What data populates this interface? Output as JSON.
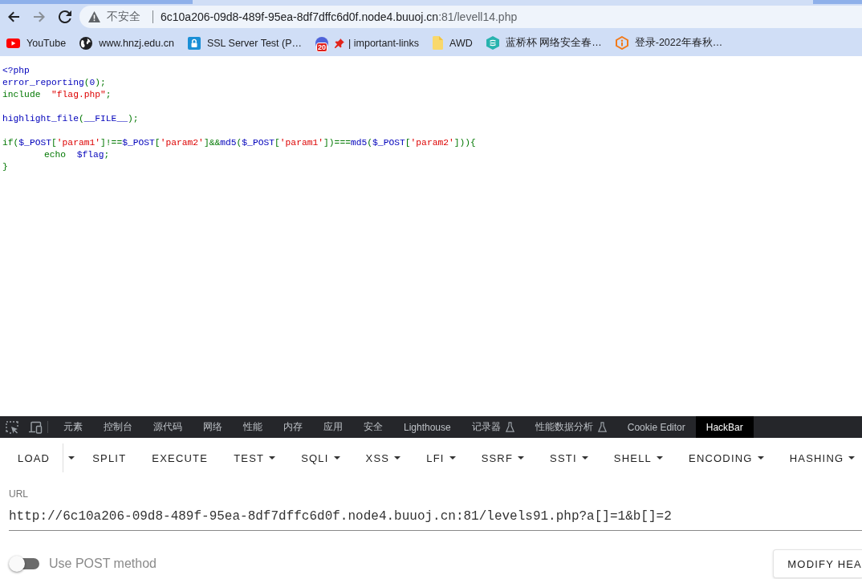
{
  "browser": {
    "nav_buttons": [
      {
        "kind": "back",
        "disabled": false
      },
      {
        "kind": "forward",
        "disabled": true
      },
      {
        "kind": "reload",
        "disabled": false
      }
    ],
    "address_bar": {
      "security_label": "不安全",
      "host": "6c10a206-09d8-489f-95ea-8df7dffc6d0f.node4.buuoj.cn",
      "path": ":81/levell14.php"
    },
    "bookmarks": [
      {
        "title": "YouTube",
        "kind": "play",
        "pinned": false
      },
      {
        "title": "www.hnzj.edu.cn",
        "kind": "globe",
        "pinned": false
      },
      {
        "title": "SSL Server Test (P…",
        "kind": "lock",
        "pinned": false
      },
      {
        "title": "| important-links",
        "kind": "counter",
        "badge": "20",
        "pinned": true
      },
      {
        "title": "AWD",
        "kind": "folder",
        "pinned": false
      },
      {
        "title": "蓝桥杯 网络安全春…",
        "kind": "stack",
        "pinned": false
      },
      {
        "title": "登录-2022年春秋…",
        "kind": "info",
        "pinned": false
      }
    ]
  },
  "page": {
    "code_lines": [
      {
        "kind": "code",
        "tokens": [
          {
            "text": "<?php",
            "kind": "default"
          }
        ]
      },
      {
        "kind": "code",
        "tokens": [
          {
            "text": "error_reporting",
            "kind": "default"
          },
          {
            "text": "(",
            "kind": "keyword"
          },
          {
            "text": "0",
            "kind": "default"
          },
          {
            "text": ");",
            "kind": "keyword"
          }
        ]
      },
      {
        "kind": "code",
        "tokens": [
          {
            "text": "include  ",
            "kind": "keyword"
          },
          {
            "text": "\"flag.php\"",
            "kind": "string"
          },
          {
            "text": ";",
            "kind": "keyword"
          }
        ]
      },
      {
        "kind": "blank"
      },
      {
        "kind": "code",
        "tokens": [
          {
            "text": "highlight_file",
            "kind": "default"
          },
          {
            "text": "(",
            "kind": "keyword"
          },
          {
            "text": "__FILE__",
            "kind": "default"
          },
          {
            "text": ");",
            "kind": "keyword"
          }
        ]
      },
      {
        "kind": "blank"
      },
      {
        "kind": "code",
        "tokens": [
          {
            "text": "if(",
            "kind": "keyword"
          },
          {
            "text": "$_POST",
            "kind": "default"
          },
          {
            "text": "[",
            "kind": "keyword"
          },
          {
            "text": "'param1'",
            "kind": "string"
          },
          {
            "text": "]!==",
            "kind": "keyword"
          },
          {
            "text": "$_POST",
            "kind": "default"
          },
          {
            "text": "[",
            "kind": "keyword"
          },
          {
            "text": "'param2'",
            "kind": "string"
          },
          {
            "text": "]&&",
            "kind": "keyword"
          },
          {
            "text": "md5",
            "kind": "default"
          },
          {
            "text": "(",
            "kind": "keyword"
          },
          {
            "text": "$_POST",
            "kind": "default"
          },
          {
            "text": "[",
            "kind": "keyword"
          },
          {
            "text": "'param1'",
            "kind": "string"
          },
          {
            "text": "])===",
            "kind": "keyword"
          },
          {
            "text": "md5",
            "kind": "default"
          },
          {
            "text": "(",
            "kind": "keyword"
          },
          {
            "text": "$_POST",
            "kind": "default"
          },
          {
            "text": "[",
            "kind": "keyword"
          },
          {
            "text": "'param2'",
            "kind": "string"
          },
          {
            "text": "])){",
            "kind": "keyword"
          }
        ],
        "children": [
          {
            "kind": "code",
            "tokens": [
              {
                "text": "echo  ",
                "kind": "keyword"
              },
              {
                "text": "$flag",
                "kind": "default"
              },
              {
                "text": ";",
                "kind": "keyword"
              }
            ]
          }
        ]
      },
      {
        "kind": "code",
        "tokens": [
          {
            "text": "}",
            "kind": "keyword"
          }
        ]
      }
    ]
  },
  "devtools": {
    "tabs": [
      {
        "label": "元素",
        "selected": false,
        "experimental": false
      },
      {
        "label": "控制台",
        "selected": false,
        "experimental": false
      },
      {
        "label": "源代码",
        "selected": false,
        "experimental": false
      },
      {
        "label": "网络",
        "selected": false,
        "experimental": false
      },
      {
        "label": "性能",
        "selected": false,
        "experimental": false
      },
      {
        "label": "内存",
        "selected": false,
        "experimental": false
      },
      {
        "label": "应用",
        "selected": false,
        "experimental": false
      },
      {
        "label": "安全",
        "selected": false,
        "experimental": false
      },
      {
        "label": "Lighthouse",
        "selected": false,
        "experimental": false
      },
      {
        "label": "记录器",
        "selected": false,
        "experimental": true
      },
      {
        "label": "性能数据分析",
        "selected": false,
        "experimental": true
      },
      {
        "label": "Cookie Editor",
        "selected": false,
        "experimental": false
      },
      {
        "label": "HackBar",
        "selected": true,
        "experimental": false
      }
    ],
    "hackbar": {
      "toolbar": [
        {
          "label": "LOAD",
          "kind": "split"
        },
        {
          "label": "SPLIT",
          "kind": "button"
        },
        {
          "label": "EXECUTE",
          "kind": "button"
        },
        {
          "label": "TEST",
          "kind": "menu"
        },
        {
          "label": "SQLI",
          "kind": "menu"
        },
        {
          "label": "XSS",
          "kind": "menu"
        },
        {
          "label": "LFI",
          "kind": "menu"
        },
        {
          "label": "SSRF",
          "kind": "menu"
        },
        {
          "label": "SSTI",
          "kind": "menu"
        },
        {
          "label": "SHELL",
          "kind": "menu"
        },
        {
          "label": "ENCODING",
          "kind": "menu"
        },
        {
          "label": "HASHING",
          "kind": "menu"
        }
      ],
      "url_field": {
        "label": "URL",
        "value": "http://6c10a206-09d8-489f-95ea-8df7dffc6d0f.node4.buuoj.cn:81/levels91.php?a[]=1&b[]=2"
      },
      "post_toggle": {
        "label": "Use POST method",
        "on": false
      },
      "modify_header_button": "MODIFY HEA"
    }
  }
}
